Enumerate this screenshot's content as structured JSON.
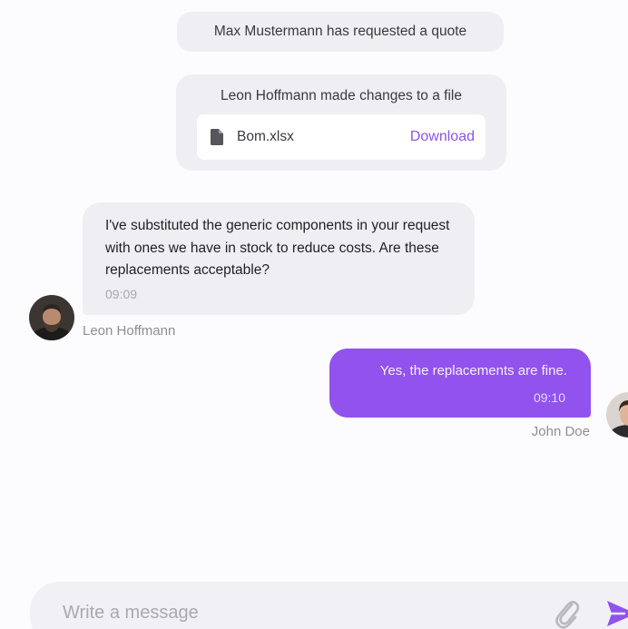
{
  "system_messages": {
    "quote_request": "Max Mustermann has requested a quote",
    "file_change": "Leon Hoffmann made changes to a file"
  },
  "file": {
    "name": "Bom.xlsx",
    "action_label": "Download",
    "icon": "file-icon"
  },
  "messages": [
    {
      "sender": "Leon Hoffmann",
      "text": "I've substituted the generic components in your request with ones we have in stock to reduce costs. Are these replacements acceptable?",
      "time": "09:09",
      "direction": "incoming"
    },
    {
      "sender": "John Doe",
      "text": "Yes, the replacements are fine.",
      "time": "09:10",
      "direction": "outgoing"
    }
  ],
  "composer": {
    "placeholder": "Write a message",
    "value": "",
    "attach_icon": "paperclip-icon",
    "send_icon": "send-icon"
  },
  "colors": {
    "accent": "#9152ee",
    "link": "#8d55e8",
    "bubble_incoming": "#efeef3",
    "background": "#fcfbfd"
  }
}
